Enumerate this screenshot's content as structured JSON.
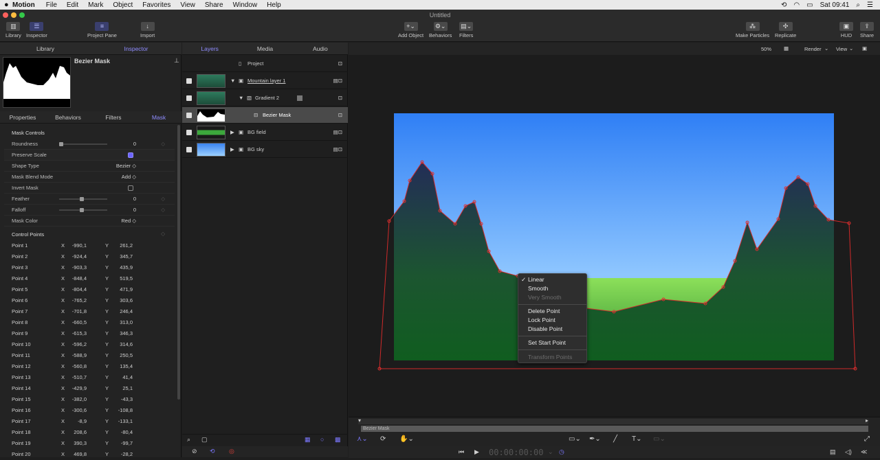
{
  "menubar": {
    "app": "Motion",
    "items": [
      "File",
      "Edit",
      "Mark",
      "Object",
      "Favorites",
      "View",
      "Share",
      "Window",
      "Help"
    ],
    "clock": "Sat 09:41"
  },
  "window": {
    "title": "Untitled"
  },
  "toolbar": {
    "library": "Library",
    "inspector": "Inspector",
    "project_pane": "Project Pane",
    "import": "Import",
    "add_object": "Add Object",
    "behaviors": "Behaviors",
    "filters": "Filters",
    "make_particles": "Make Particles",
    "replicate": "Replicate",
    "hud": "HUD",
    "share": "Share"
  },
  "left": {
    "tabs": [
      "Library",
      "Inspector"
    ],
    "preview_title": "Bezier Mask",
    "subtabs": [
      "Properties",
      "Behaviors",
      "Filters",
      "Mask"
    ],
    "section": "Mask Controls",
    "props": {
      "roundness": {
        "label": "Roundness",
        "value": "0"
      },
      "preserve_scale": {
        "label": "Preserve Scale"
      },
      "shape_type": {
        "label": "Shape Type",
        "value": "Bezier ◇"
      },
      "blend_mode": {
        "label": "Mask Blend Mode",
        "value": "Add ◇"
      },
      "invert": {
        "label": "Invert Mask"
      },
      "feather": {
        "label": "Feather",
        "value": "0"
      },
      "falloff": {
        "label": "Falloff",
        "value": "0"
      },
      "mask_color": {
        "label": "Mask Color",
        "value": "Red ◇"
      }
    },
    "control_points_title": "Control Points",
    "points": [
      {
        "n": "Point 1",
        "x": "-990,1",
        "y": "261,2"
      },
      {
        "n": "Point 2",
        "x": "-924,4",
        "y": "345,7"
      },
      {
        "n": "Point 3",
        "x": "-903,3",
        "y": "435,9"
      },
      {
        "n": "Point 4",
        "x": "-848,4",
        "y": "519,5"
      },
      {
        "n": "Point 5",
        "x": "-804,4",
        "y": "471,9"
      },
      {
        "n": "Point 6",
        "x": "-765,2",
        "y": "303,6"
      },
      {
        "n": "Point 7",
        "x": "-701,8",
        "y": "246,4"
      },
      {
        "n": "Point 8",
        "x": "-660,5",
        "y": "313,0"
      },
      {
        "n": "Point 9",
        "x": "-615,3",
        "y": "346,3"
      },
      {
        "n": "Point 10",
        "x": "-596,2",
        "y": "314,6"
      },
      {
        "n": "Point 11",
        "x": "-588,9",
        "y": "250,5"
      },
      {
        "n": "Point 12",
        "x": "-560,8",
        "y": "135,4"
      },
      {
        "n": "Point 13",
        "x": "-510,7",
        "y": "41,4"
      },
      {
        "n": "Point 14",
        "x": "-429,9",
        "y": "25,1"
      },
      {
        "n": "Point 15",
        "x": "-382,0",
        "y": "-43,3"
      },
      {
        "n": "Point 16",
        "x": "-300,6",
        "y": "-108,8"
      },
      {
        "n": "Point 17",
        "x": "-8,9",
        "y": "-133,1"
      },
      {
        "n": "Point 18",
        "x": "208,6",
        "y": "-80,4"
      },
      {
        "n": "Point 19",
        "x": "390,3",
        "y": "-99,7"
      },
      {
        "n": "Point 20",
        "x": "469,8",
        "y": "-28,2"
      }
    ],
    "x_label": "X",
    "y_label": "Y"
  },
  "layers": {
    "tabs": [
      "Layers",
      "Media",
      "Audio"
    ],
    "project": "Project",
    "rows": [
      "Mountain layer 1",
      "Gradient 2",
      "Bezier Mask",
      "BG field",
      "BG sky"
    ]
  },
  "viewer": {
    "zoom": "50%",
    "render": "Render",
    "view": "View"
  },
  "context_menu": {
    "linear": "Linear",
    "smooth": "Smooth",
    "very_smooth": "Very Smooth",
    "delete": "Delete Point",
    "lock": "Lock Point",
    "disable": "Disable Point",
    "start": "Set Start Point",
    "transform": "Transform Points"
  },
  "timeline": {
    "track_label": "Bezier Mask",
    "timecode": "00:00:00:00"
  }
}
